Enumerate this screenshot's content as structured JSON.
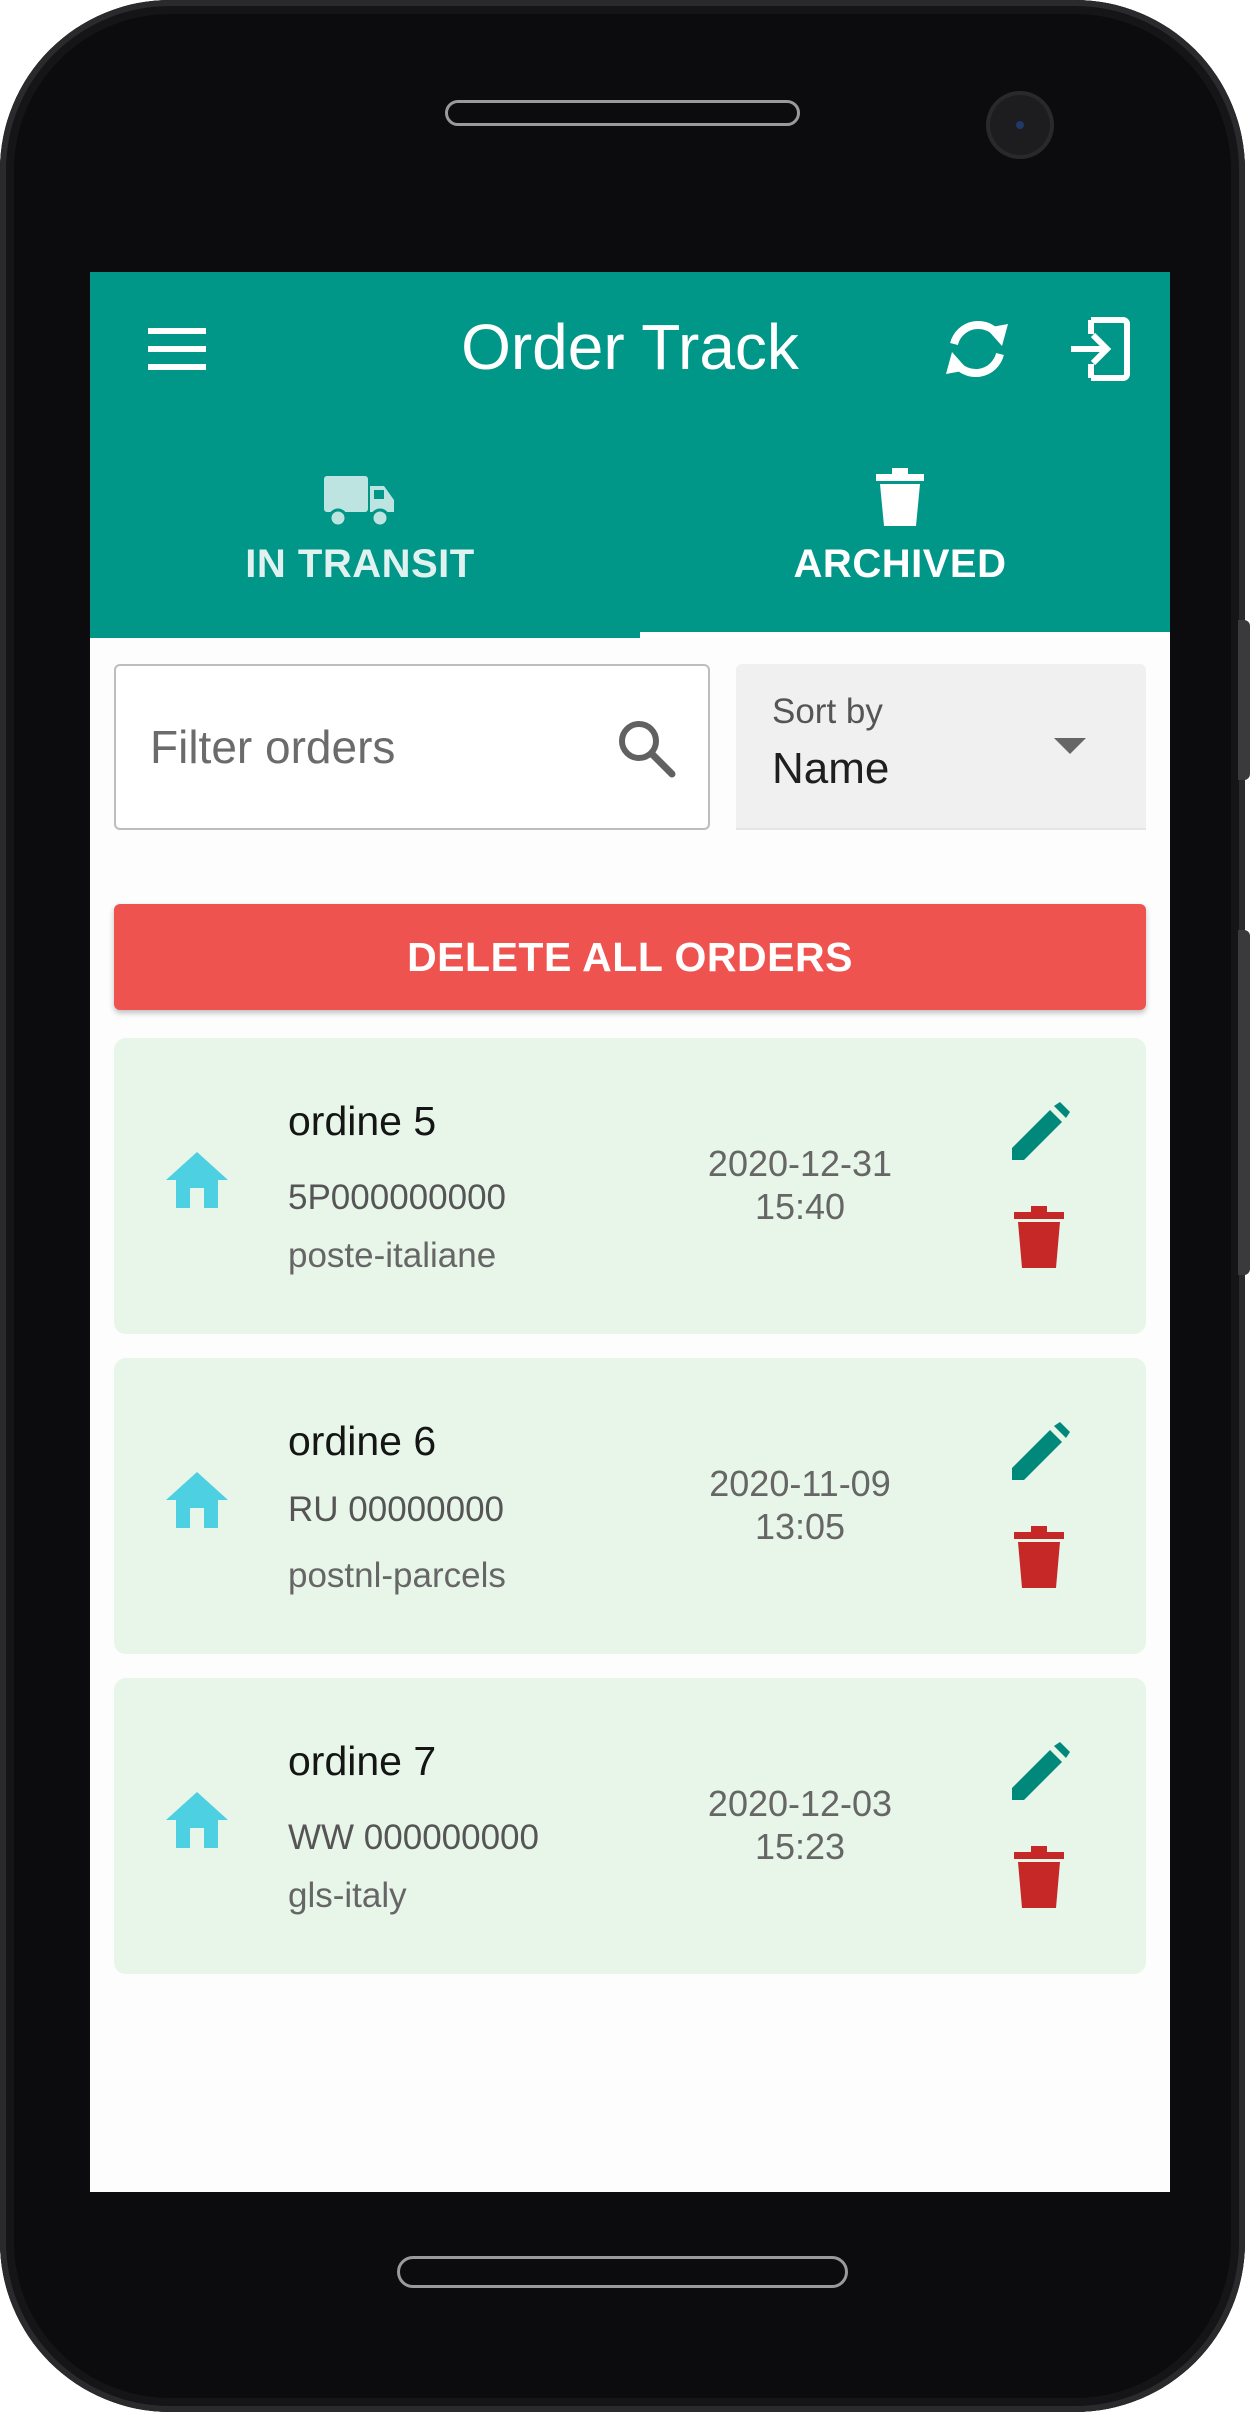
{
  "app": {
    "title": "Order Track",
    "accent_color": "#009688",
    "menu_icon": "menu-icon",
    "refresh_icon": "refresh-icon",
    "logout_icon": "logout-icon"
  },
  "tabs": [
    {
      "label": "IN TRANSIT",
      "icon": "truck-icon",
      "selected": false
    },
    {
      "label": "ARCHIVED",
      "icon": "trash-icon",
      "selected": true
    }
  ],
  "filter": {
    "placeholder": "Filter orders",
    "value": "",
    "icon": "search-icon"
  },
  "sort": {
    "label": "Sort by",
    "value": "Name",
    "icon": "dropdown-arrow-icon"
  },
  "delete_all": {
    "label": "DELETE ALL ORDERS",
    "color": "#ef5350"
  },
  "orders": [
    {
      "name": "ordine 5",
      "code": "5P000000000",
      "carrier": "poste-italiane",
      "date": "2020-12-31",
      "time": "15:40"
    },
    {
      "name": "ordine 6",
      "code": "RU 00000000",
      "carrier": "postnl-parcels",
      "date": "2020-11-09",
      "time": "13:05"
    },
    {
      "name": "ordine 7",
      "code": "WW 000000000",
      "carrier": "gls-italy",
      "date": "2020-12-03",
      "time": "15:23"
    }
  ],
  "colors": {
    "card_background": "#e8f5e9",
    "home_icon": "#4dd0e1",
    "edit_icon": "#00897b",
    "delete_icon": "#c62828"
  }
}
